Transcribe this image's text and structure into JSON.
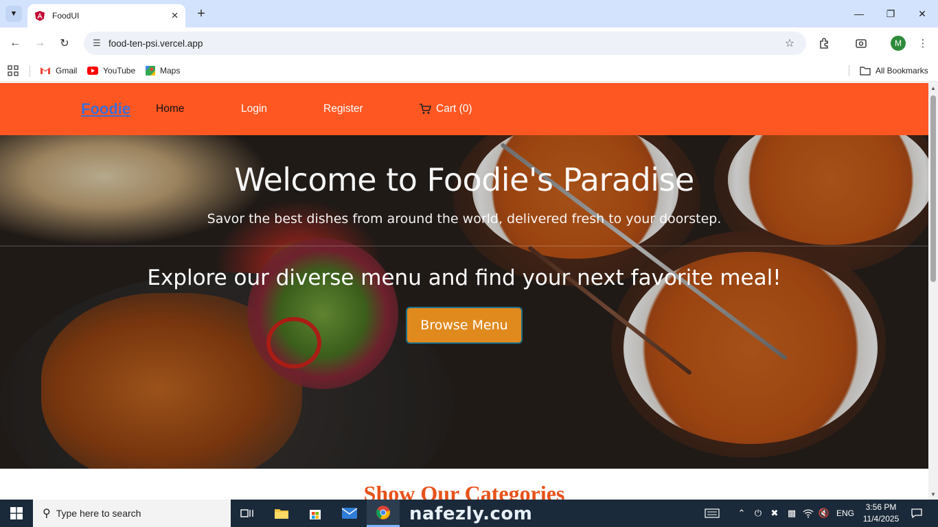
{
  "browser": {
    "tab_title": "FoodUI",
    "url": "food-ten-psi.vercel.app",
    "bookmarks": [
      {
        "label": "Gmail",
        "icon": "gmail-icon"
      },
      {
        "label": "YouTube",
        "icon": "youtube-icon"
      },
      {
        "label": "Maps",
        "icon": "maps-icon"
      }
    ],
    "all_bookmarks": "All Bookmarks",
    "profile_initial": "M"
  },
  "site": {
    "brand": "Foodie",
    "nav": {
      "home": "Home",
      "login": "Login",
      "register": "Register",
      "cart": "Cart (0)"
    },
    "hero": {
      "title": "Welcome to Foodie's Paradise",
      "subtitle": "Savor the best dishes from around the world, delivered fresh to your doorstep.",
      "explore": "Explore our diverse menu and find your next favorite meal!",
      "button": "Browse Menu"
    },
    "section_heading": "Show Our Categories",
    "colors": {
      "nav_bg": "#ff5722",
      "brand": "#3b6fd8",
      "button_bg": "#e08a1e",
      "heading": "#e8521a"
    }
  },
  "taskbar": {
    "search_placeholder": "Type here to search",
    "language": "ENG",
    "time": "3:56 PM",
    "date": "11/4/2025",
    "watermark": "nafezly.com"
  }
}
